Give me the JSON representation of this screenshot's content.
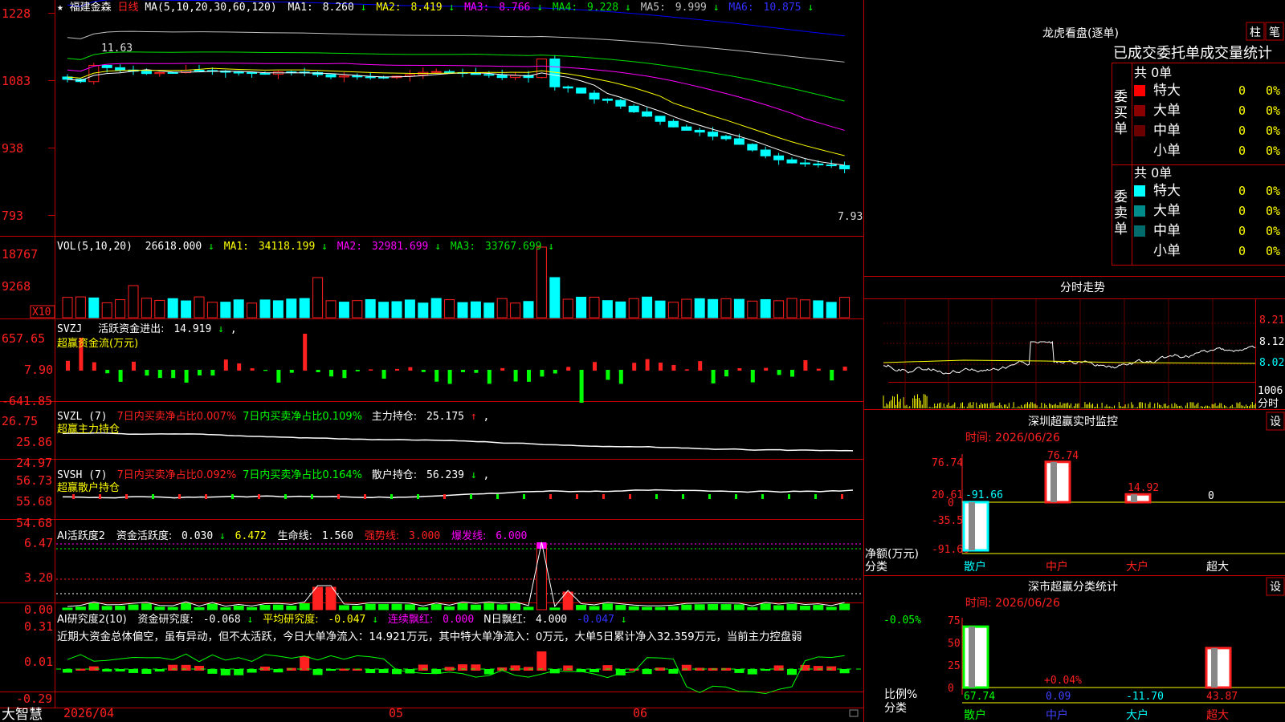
{
  "colors": {
    "up": "#ff2020",
    "down": "#00ffff",
    "ma1": "#ffffff",
    "ma2": "#ffff00",
    "ma3": "#ff00ff",
    "ma4": "#00e000",
    "ma5": "#c0c0c0",
    "ma6": "#0000ff",
    "grid": "#c00000"
  },
  "price_panel": {
    "star": "★",
    "name": "福建金森",
    "period": "日线",
    "ma_params": "MA(5,10,20,30,60,120)",
    "mas": [
      {
        "label": "MA1:",
        "value": "8.260",
        "arrow": "↓"
      },
      {
        "label": "MA2:",
        "value": "8.419",
        "arrow": "↓"
      },
      {
        "label": "MA3:",
        "value": "8.766",
        "arrow": "↓"
      },
      {
        "label": "MA4:",
        "value": "9.228",
        "arrow": "↓"
      },
      {
        "label": "MA5:",
        "value": "9.999",
        "arrow": "↓"
      },
      {
        "label": "MA6:",
        "value": "10.875",
        "arrow": "↓"
      }
    ],
    "y_labels": [
      "1228",
      "1083",
      "938",
      "793"
    ],
    "high_label": "11.63",
    "low_label": "7.93"
  },
  "vol_panel": {
    "params": "VOL(5,10,20)",
    "vol_value": "26618.000",
    "vol_arrow": "↓",
    "mas": [
      {
        "label": "MA1:",
        "value": "34118.199",
        "arrow": "↓"
      },
      {
        "label": "MA2:",
        "value": "32981.699",
        "arrow": "↓"
      },
      {
        "label": "MA3:",
        "value": "33767.699",
        "arrow": "↓"
      }
    ],
    "y_labels": [
      "18767",
      "9268"
    ],
    "unit": "X10"
  },
  "svzj_panel": {
    "name": "SVZJ",
    "label": "活跃资金进出:",
    "value": "14.919",
    "arrow": "↓",
    "comma": ",",
    "subtitle": "超赢资金流(万元)",
    "y_labels": [
      "657.65",
      "7.90",
      "-641.85"
    ]
  },
  "svzl_panel": {
    "name": "SVZL (7)",
    "t1": "7日内买卖净占比0.007%",
    "t2": "7日内买卖净占比0.109%",
    "label": "主力持仓:",
    "value": "25.175",
    "arrow": "↑",
    "comma": ",",
    "subtitle": "超赢主力持仓",
    "y_labels": [
      "26.75",
      "25.86",
      "24.97"
    ]
  },
  "svsh_panel": {
    "name": "SVSH (7)",
    "t1": "7日内买卖净占比0.092%",
    "t2": "7日内买卖净占比0.164%",
    "label": "散户持仓:",
    "value": "56.239",
    "arrow": "↓",
    "comma": ",",
    "subtitle": "超赢散户持仓",
    "y_labels": [
      "56.73",
      "55.68",
      "54.68"
    ]
  },
  "ai_active_panel": {
    "name": "AI活跃度2",
    "l1": "资金活跃度:",
    "v1": "0.030",
    "a1": "↓",
    "v2": "6.472",
    "l3": "生命线:",
    "v3": "1.560",
    "l4": "强势线:",
    "v4": "3.000",
    "l5": "爆发线:",
    "v5": "6.000",
    "y_labels": [
      "6.47",
      "3.20",
      "0.00"
    ]
  },
  "ai_research_panel": {
    "name": "AI研究度2(10)",
    "l1": "资金研究度:",
    "v1": "-0.068",
    "a1": "↓",
    "l2": "平均研究度:",
    "v2": "-0.047",
    "a2": "↓",
    "l3": "连续飘红:",
    "v3": "0.000",
    "l4": "N日飘红:",
    "v4": "4.000",
    "v5": "-0.047",
    "a5": "↓",
    "comment": "近期大资金总体偏空，虽有异动，但不太活跃，今日大单净流入：14.921万元，其中特大单净流入：0万元，大单5日累计净入32.359万元，当前主力控盘弱",
    "y_labels": [
      "0.31",
      "0.01",
      "-0.29"
    ]
  },
  "time_axis": {
    "labels": [
      "2026/04",
      "05",
      "06"
    ]
  },
  "brand": "大智慧",
  "dragon_tiger": {
    "title": "龙虎看盘(逐单)",
    "btn_bar": "柱",
    "btn_stroke": "笔",
    "header": "已成交委托单成交量统计",
    "buy": {
      "side": "委买单",
      "total": "共 0单",
      "rows": [
        {
          "label": "特大",
          "count": "0",
          "pct": "0%",
          "color": "#ff0000"
        },
        {
          "label": "大单",
          "count": "0",
          "pct": "0%",
          "color": "#8b0000"
        },
        {
          "label": "中单",
          "count": "0",
          "pct": "0%",
          "color": "#6b0000"
        },
        {
          "label": "小单",
          "count": "0",
          "pct": "0%",
          "color": ""
        }
      ]
    },
    "sell": {
      "side": "委卖单",
      "total": "共 0单",
      "rows": [
        {
          "label": "特大",
          "count": "0",
          "pct": "0%",
          "color": "#00ffff"
        },
        {
          "label": "大单",
          "count": "0",
          "pct": "0%",
          "color": "#008b8b"
        },
        {
          "label": "中单",
          "count": "0",
          "pct": "0%",
          "color": "#006b6b"
        },
        {
          "label": "小单",
          "count": "0",
          "pct": "0%",
          "color": ""
        }
      ]
    }
  },
  "intraday": {
    "title": "分时走势",
    "y_labels": [
      "8.21",
      "8.12",
      "8.02"
    ],
    "vol_label": "1006",
    "unit_label": "分时"
  },
  "sz_monitor": {
    "title": "深圳超赢实时监控",
    "btn": "设",
    "time": "时间: 2026/06/26",
    "y_labels": [
      "76.74",
      "20.61",
      "0",
      "-35.53",
      "-91.66"
    ],
    "bars": [
      {
        "cat": "散户",
        "value": "-91.66",
        "color": "#00ffff"
      },
      {
        "cat": "中户",
        "value": "76.74",
        "color": "#ff2020"
      },
      {
        "cat": "大户",
        "value": "14.92",
        "color": "#ff2020"
      },
      {
        "cat": "超大",
        "value": "0",
        "color": "#ffffff"
      }
    ],
    "axis_title1": "净额(万元)",
    "axis_title2": "分类"
  },
  "sz_class": {
    "title": "深市超赢分类统计",
    "btn": "设",
    "time": "时间: 2026/06/26",
    "y_labels": [
      "75",
      "50",
      "25",
      "0"
    ],
    "top_labels": [
      "-0.05%",
      "+0.04%"
    ],
    "bars": [
      {
        "cat": "散户",
        "value": "67.74",
        "color": "#00ff00"
      },
      {
        "cat": "中户",
        "value": "0.09",
        "color": "#4040ff"
      },
      {
        "cat": "大户",
        "value": "-11.70",
        "color": "#00ffff"
      },
      {
        "cat": "超大",
        "value": "43.87",
        "color": "#ff2020"
      }
    ],
    "axis_title1": "比例%",
    "axis_title2": "分类"
  }
}
